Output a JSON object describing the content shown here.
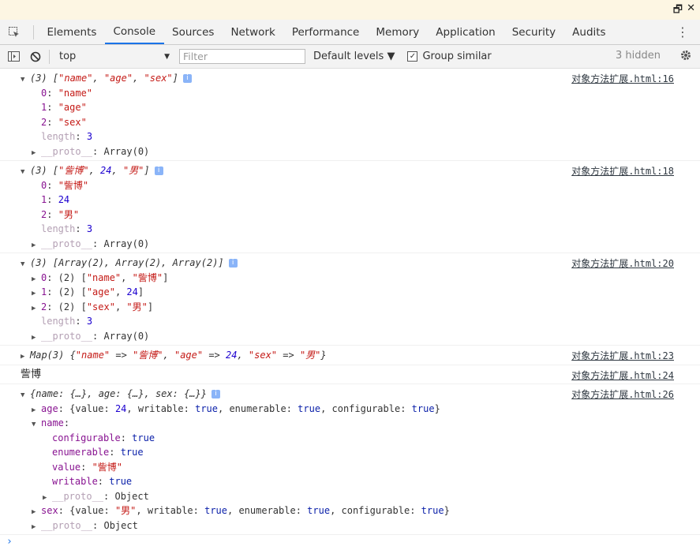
{
  "window": {
    "restore_glyph": "🗗",
    "close_glyph": "✕"
  },
  "tabs": [
    "Elements",
    "Console",
    "Sources",
    "Network",
    "Performance",
    "Memory",
    "Application",
    "Security",
    "Audits"
  ],
  "toolbar": {
    "context": "top",
    "filter_placeholder": "Filter",
    "levels": "Default levels ▼",
    "group_similar": "Group similar",
    "hidden": "3 hidden"
  },
  "messages": [
    {
      "source": "对象方法扩展.html:16"
    },
    {
      "source": "对象方法扩展.html:18"
    },
    {
      "source": "对象方法扩展.html:20"
    },
    {
      "source": "对象方法扩展.html:23"
    },
    {
      "source": "对象方法扩展.html:24",
      "text": "訾博"
    },
    {
      "source": "对象方法扩展.html:26"
    }
  ]
}
